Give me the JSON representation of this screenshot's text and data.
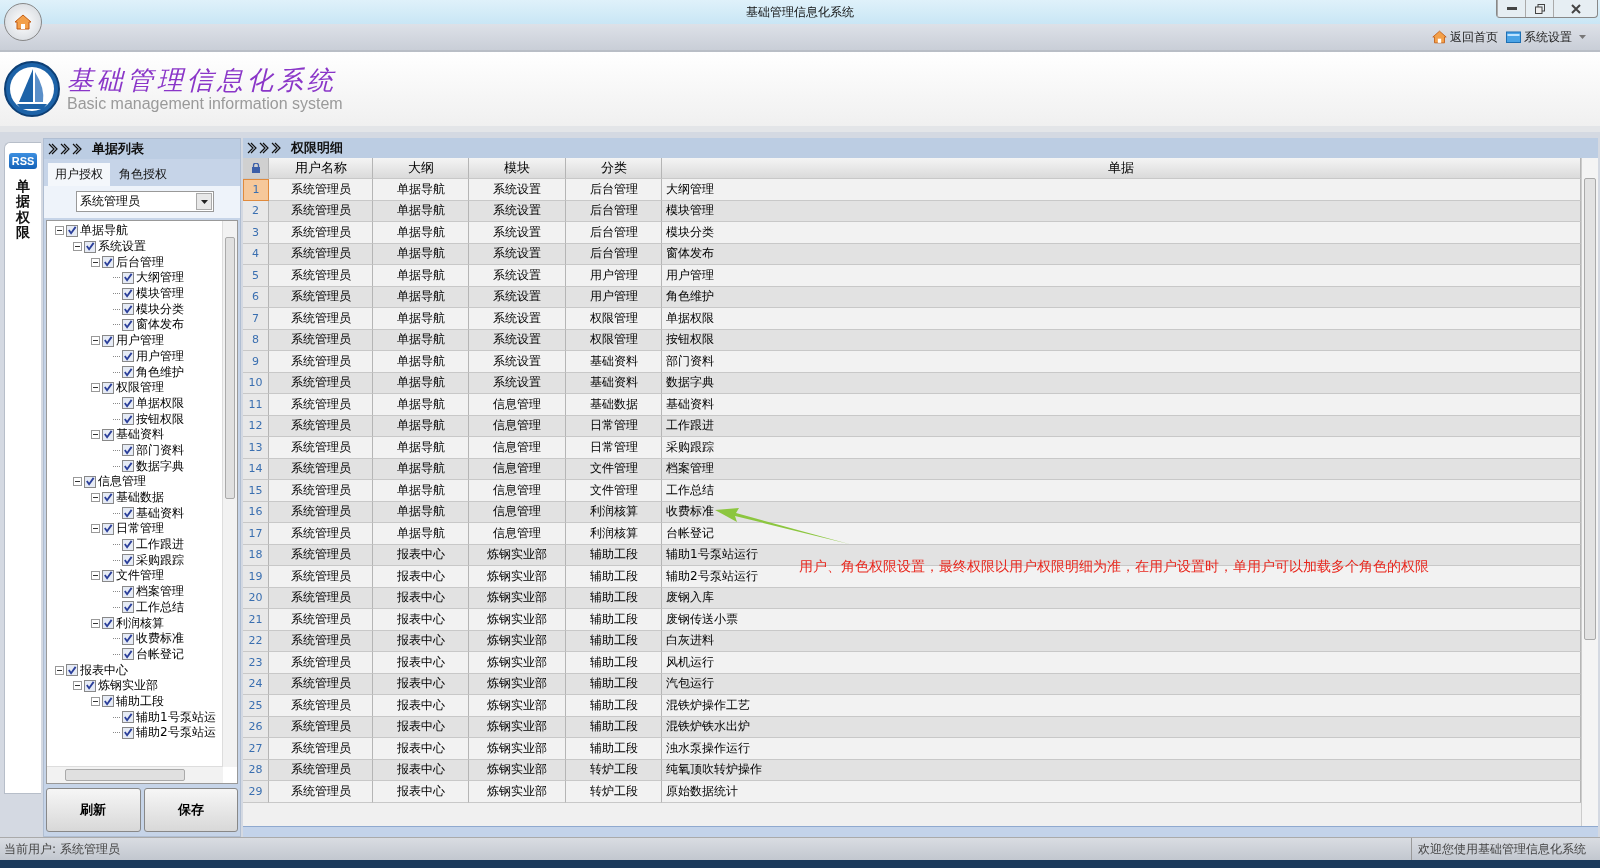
{
  "window": {
    "title": "基础管理信息化系统"
  },
  "toolbar": {
    "items": [
      {
        "kind": "home",
        "label": "返回首页"
      },
      {
        "kind": "settings",
        "label": "系统设置"
      }
    ]
  },
  "header": {
    "title": "基础管理信息化系统",
    "subtitle": "Basic management information system"
  },
  "side_tab": {
    "badge": "RSS",
    "label": "单据权限"
  },
  "left_panel": {
    "title": "单据列表",
    "tabs": [
      {
        "label": "用户授权",
        "selected": true
      },
      {
        "label": "角色授权",
        "selected": false
      }
    ],
    "combo": {
      "value": "系统管理员"
    },
    "tree": [
      {
        "label": "单据导航",
        "checked": true,
        "expanded": true,
        "children": [
          {
            "label": "系统设置",
            "checked": true,
            "expanded": true,
            "children": [
              {
                "label": "后台管理",
                "checked": true,
                "expanded": true,
                "children": [
                  {
                    "label": "大纲管理",
                    "checked": true
                  },
                  {
                    "label": "模块管理",
                    "checked": true
                  },
                  {
                    "label": "模块分类",
                    "checked": true
                  },
                  {
                    "label": "窗体发布",
                    "checked": true
                  }
                ]
              },
              {
                "label": "用户管理",
                "checked": true,
                "expanded": true,
                "children": [
                  {
                    "label": "用户管理",
                    "checked": true
                  },
                  {
                    "label": "角色维护",
                    "checked": true
                  }
                ]
              },
              {
                "label": "权限管理",
                "checked": true,
                "expanded": true,
                "children": [
                  {
                    "label": "单据权限",
                    "checked": true
                  },
                  {
                    "label": "按钮权限",
                    "checked": true
                  }
                ]
              },
              {
                "label": "基础资料",
                "checked": true,
                "expanded": true,
                "children": [
                  {
                    "label": "部门资料",
                    "checked": true
                  },
                  {
                    "label": "数据字典",
                    "checked": true
                  }
                ]
              }
            ]
          },
          {
            "label": "信息管理",
            "checked": true,
            "expanded": true,
            "children": [
              {
                "label": "基础数据",
                "checked": true,
                "expanded": true,
                "children": [
                  {
                    "label": "基础资料",
                    "checked": true
                  }
                ]
              },
              {
                "label": "日常管理",
                "checked": true,
                "expanded": true,
                "children": [
                  {
                    "label": "工作跟进",
                    "checked": true
                  },
                  {
                    "label": "采购跟踪",
                    "checked": true
                  }
                ]
              },
              {
                "label": "文件管理",
                "checked": true,
                "expanded": true,
                "children": [
                  {
                    "label": "档案管理",
                    "checked": true
                  },
                  {
                    "label": "工作总结",
                    "checked": true
                  }
                ]
              },
              {
                "label": "利润核算",
                "checked": true,
                "expanded": true,
                "children": [
                  {
                    "label": "收费标准",
                    "checked": true
                  },
                  {
                    "label": "台帐登记",
                    "checked": true
                  }
                ]
              }
            ]
          }
        ]
      },
      {
        "label": "报表中心",
        "checked": true,
        "expanded": true,
        "children": [
          {
            "label": "炼钢实业部",
            "checked": true,
            "expanded": true,
            "children": [
              {
                "label": "辅助工段",
                "checked": true,
                "expanded": true,
                "children": [
                  {
                    "label": "辅助1号泵站运",
                    "checked": true
                  },
                  {
                    "label": "辅助2号泵站运",
                    "checked": true
                  }
                ]
              }
            ]
          }
        ]
      }
    ],
    "buttons": [
      "刷新",
      "保存"
    ]
  },
  "table": {
    "title": "权限明细",
    "columns": [
      "用户名称",
      "大纲",
      "模块",
      "分类",
      "单据"
    ],
    "rows": [
      {
        "n": "1",
        "cells": [
          "系统管理员",
          "单据导航",
          "系统设置",
          "后台管理",
          "大纲管理"
        ],
        "selected": true
      },
      {
        "n": "2",
        "cells": [
          "系统管理员",
          "单据导航",
          "系统设置",
          "后台管理",
          "模块管理"
        ],
        "selected": false
      },
      {
        "n": "3",
        "cells": [
          "系统管理员",
          "单据导航",
          "系统设置",
          "后台管理",
          "模块分类"
        ],
        "selected": false
      },
      {
        "n": "4",
        "cells": [
          "系统管理员",
          "单据导航",
          "系统设置",
          "后台管理",
          "窗体发布"
        ],
        "selected": false
      },
      {
        "n": "5",
        "cells": [
          "系统管理员",
          "单据导航",
          "系统设置",
          "用户管理",
          "用户管理"
        ],
        "selected": false
      },
      {
        "n": "6",
        "cells": [
          "系统管理员",
          "单据导航",
          "系统设置",
          "用户管理",
          "角色维护"
        ],
        "selected": false
      },
      {
        "n": "7",
        "cells": [
          "系统管理员",
          "单据导航",
          "系统设置",
          "权限管理",
          "单据权限"
        ],
        "selected": false
      },
      {
        "n": "8",
        "cells": [
          "系统管理员",
          "单据导航",
          "系统设置",
          "权限管理",
          "按钮权限"
        ],
        "selected": false
      },
      {
        "n": "9",
        "cells": [
          "系统管理员",
          "单据导航",
          "系统设置",
          "基础资料",
          "部门资料"
        ],
        "selected": false
      },
      {
        "n": "10",
        "cells": [
          "系统管理员",
          "单据导航",
          "系统设置",
          "基础资料",
          "数据字典"
        ],
        "selected": false
      },
      {
        "n": "11",
        "cells": [
          "系统管理员",
          "单据导航",
          "信息管理",
          "基础数据",
          "基础资料"
        ],
        "selected": false
      },
      {
        "n": "12",
        "cells": [
          "系统管理员",
          "单据导航",
          "信息管理",
          "日常管理",
          "工作跟进"
        ],
        "selected": false
      },
      {
        "n": "13",
        "cells": [
          "系统管理员",
          "单据导航",
          "信息管理",
          "日常管理",
          "采购跟踪"
        ],
        "selected": false
      },
      {
        "n": "14",
        "cells": [
          "系统管理员",
          "单据导航",
          "信息管理",
          "文件管理",
          "档案管理"
        ],
        "selected": false
      },
      {
        "n": "15",
        "cells": [
          "系统管理员",
          "单据导航",
          "信息管理",
          "文件管理",
          "工作总结"
        ],
        "selected": false
      },
      {
        "n": "16",
        "cells": [
          "系统管理员",
          "单据导航",
          "信息管理",
          "利润核算",
          "收费标准"
        ],
        "selected": false
      },
      {
        "n": "17",
        "cells": [
          "系统管理员",
          "单据导航",
          "信息管理",
          "利润核算",
          "台帐登记"
        ],
        "selected": false
      },
      {
        "n": "18",
        "cells": [
          "系统管理员",
          "报表中心",
          "炼钢实业部",
          "辅助工段",
          "辅助1号泵站运行"
        ],
        "selected": false
      },
      {
        "n": "19",
        "cells": [
          "系统管理员",
          "报表中心",
          "炼钢实业部",
          "辅助工段",
          "辅助2号泵站运行"
        ],
        "selected": false
      },
      {
        "n": "20",
        "cells": [
          "系统管理员",
          "报表中心",
          "炼钢实业部",
          "辅助工段",
          "废钢入库"
        ],
        "selected": false
      },
      {
        "n": "21",
        "cells": [
          "系统管理员",
          "报表中心",
          "炼钢实业部",
          "辅助工段",
          "废钢传送小票"
        ],
        "selected": false
      },
      {
        "n": "22",
        "cells": [
          "系统管理员",
          "报表中心",
          "炼钢实业部",
          "辅助工段",
          "白灰进料"
        ],
        "selected": false
      },
      {
        "n": "23",
        "cells": [
          "系统管理员",
          "报表中心",
          "炼钢实业部",
          "辅助工段",
          "风机运行"
        ],
        "selected": false
      },
      {
        "n": "24",
        "cells": [
          "系统管理员",
          "报表中心",
          "炼钢实业部",
          "辅助工段",
          "汽包运行"
        ],
        "selected": false
      },
      {
        "n": "25",
        "cells": [
          "系统管理员",
          "报表中心",
          "炼钢实业部",
          "辅助工段",
          "混铁炉操作工艺"
        ],
        "selected": false
      },
      {
        "n": "26",
        "cells": [
          "系统管理员",
          "报表中心",
          "炼钢实业部",
          "辅助工段",
          "混铁炉铁水出炉"
        ],
        "selected": false
      },
      {
        "n": "27",
        "cells": [
          "系统管理员",
          "报表中心",
          "炼钢实业部",
          "辅助工段",
          "浊水泵操作运行"
        ],
        "selected": false
      },
      {
        "n": "28",
        "cells": [
          "系统管理员",
          "报表中心",
          "炼钢实业部",
          "转炉工段",
          "纯氧顶吹转炉操作"
        ],
        "selected": false
      },
      {
        "n": "29",
        "cells": [
          "系统管理员",
          "报表中心",
          "炼钢实业部",
          "转炉工段",
          "原始数据统计"
        ],
        "selected": false
      }
    ],
    "annotation": "用户、角色权限设置，最终权限以用户权限明细为准，在用户设置时，单用户可以加载多个角色的权限"
  },
  "status_bar": {
    "left": "当前用户: 系统管理员",
    "right": "欢迎您使用基础管理信息化系统"
  }
}
